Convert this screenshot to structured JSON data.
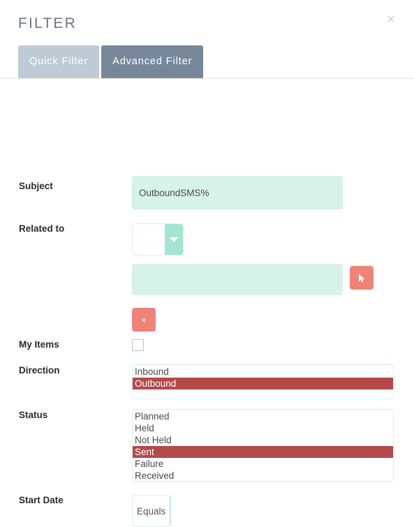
{
  "header": {
    "title": "FILTER",
    "close_label": "×"
  },
  "tabs": [
    {
      "label": "Quick Filter",
      "active": false,
      "name": "tab-quick-filter"
    },
    {
      "label": "Advanced Filter",
      "active": true,
      "name": "tab-advanced-filter"
    }
  ],
  "fields": {
    "subject": {
      "label": "Subject",
      "value": "OutboundSMS%",
      "placeholder": ""
    },
    "related_to": {
      "label": "Related to",
      "module_value": "",
      "module_placeholder": "",
      "text_value": "",
      "text_placeholder": "",
      "pick_button_label": "",
      "clear_button_label": "×"
    },
    "my_items": {
      "label": "My Items",
      "checked": false
    },
    "direction": {
      "label": "Direction",
      "options": [
        {
          "label": "Inbound",
          "selected": false
        },
        {
          "label": "Outbound",
          "selected": true
        }
      ]
    },
    "status": {
      "label": "Status",
      "options": [
        {
          "label": "Planned",
          "selected": false
        },
        {
          "label": "Held",
          "selected": false
        },
        {
          "label": "Not Held",
          "selected": false
        },
        {
          "label": "Sent",
          "selected": true
        },
        {
          "label": "Failure",
          "selected": false
        },
        {
          "label": "Received",
          "selected": false
        }
      ]
    },
    "start_date": {
      "label": "Start Date",
      "operator_value": "Equals"
    }
  },
  "colors": {
    "tab_active_bg": "#76879a",
    "tab_inactive_bg": "#bfcbd4",
    "input_mint_bg": "#d7f2e9",
    "dropdown_arrow_bg": "#a6e4d1",
    "action_button_bg": "#ef8378",
    "selection_bg": "#b4494a",
    "title_color": "#6b7687"
  }
}
